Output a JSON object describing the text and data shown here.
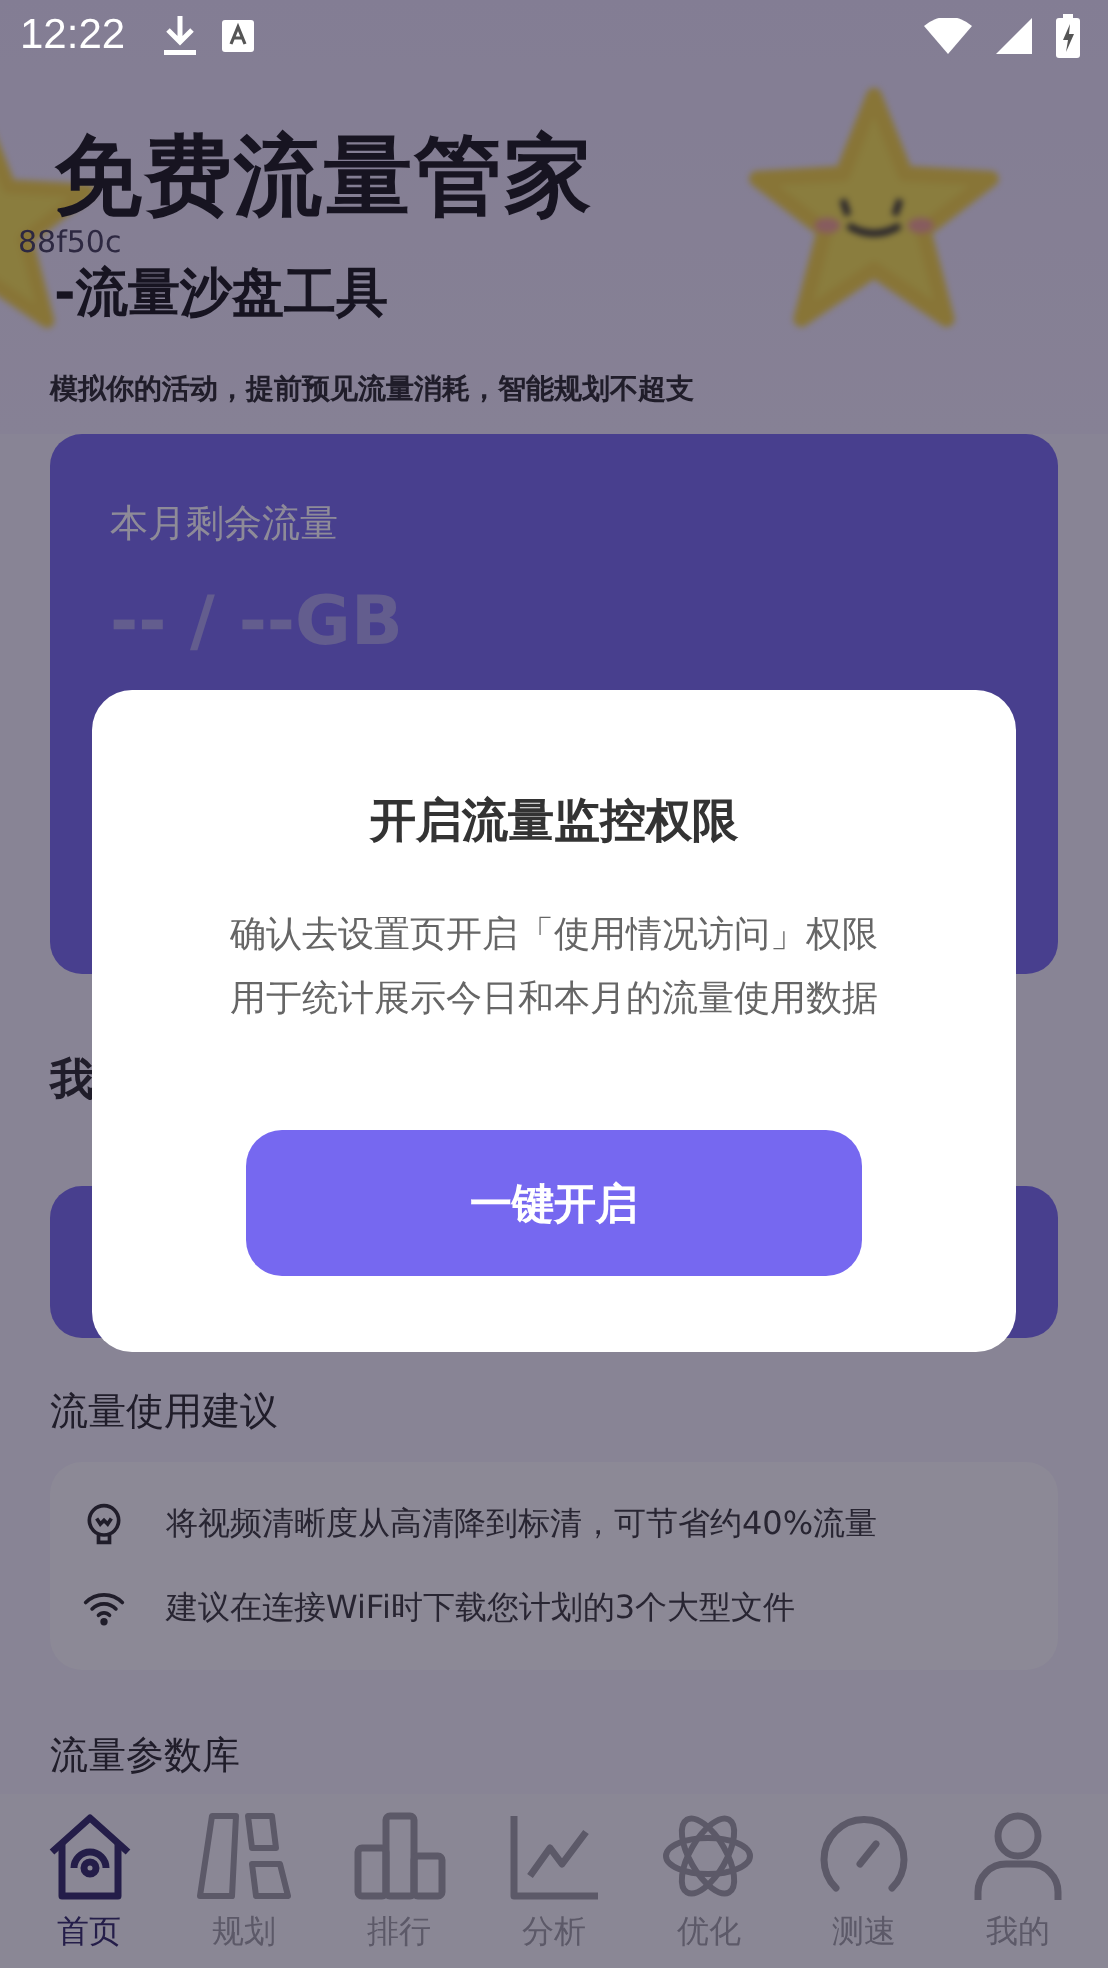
{
  "status_bar": {
    "time": "12:22"
  },
  "header": {
    "title": "免费流量管家",
    "subtitle": "-流量沙盘工具",
    "tagline": "模拟你的活动，提前预见流量消耗，智能规划不超支",
    "debug_text": "88f50c"
  },
  "remaining_card": {
    "label": "本月剩余流量",
    "value": "-- / --GB"
  },
  "partial_section": {
    "title": "我"
  },
  "tips_section": {
    "title": "流量使用建议",
    "tips": [
      {
        "kind": "bulb",
        "text": "将视频清晰度从高清降到标清，可节省约40%流量"
      },
      {
        "kind": "wifi",
        "text": "建议在连接WiFi时下载您计划的3个大型文件"
      }
    ]
  },
  "library_section": {
    "title": "流量参数库"
  },
  "nav": {
    "items": [
      {
        "kind": "home",
        "label": "首页",
        "selected": true
      },
      {
        "kind": "plan",
        "label": "规划",
        "selected": false
      },
      {
        "kind": "rank",
        "label": "排行",
        "selected": false
      },
      {
        "kind": "chart",
        "label": "分析",
        "selected": false
      },
      {
        "kind": "atom",
        "label": "优化",
        "selected": false
      },
      {
        "kind": "gauge",
        "label": "测速",
        "selected": false
      },
      {
        "kind": "user",
        "label": "我的",
        "selected": false
      }
    ]
  },
  "dialog": {
    "title": "开启流量监控权限",
    "lines": [
      "确认去设置页开启「使用情况访问」权限",
      "用于统计展示今日和本月的流量使用数据"
    ],
    "button": "一键开启"
  }
}
